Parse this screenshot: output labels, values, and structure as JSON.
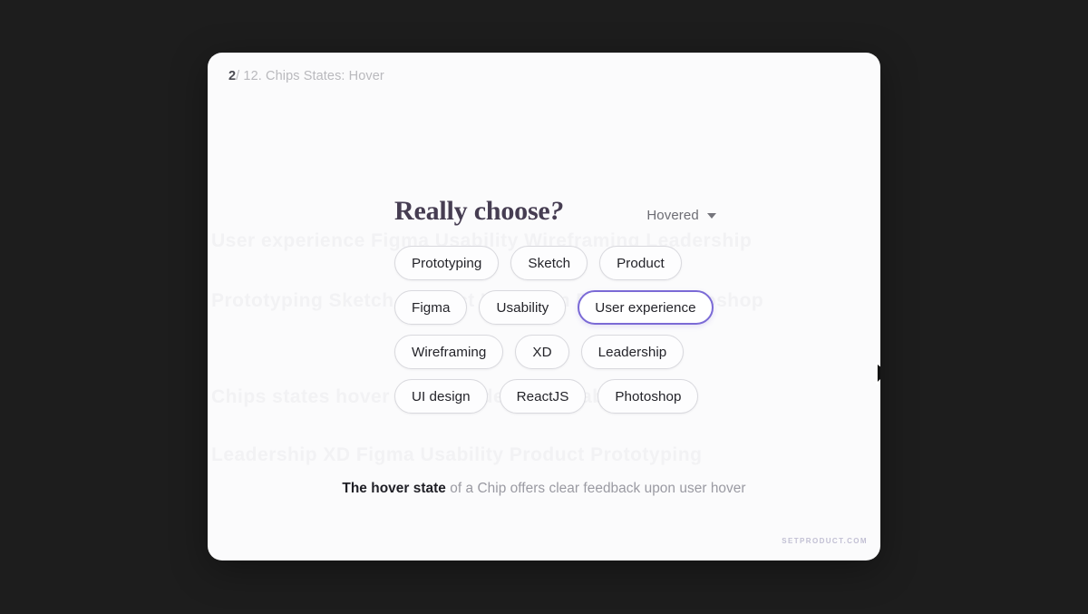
{
  "background_color": "#1d1d1d",
  "card": {
    "background_color": "#fbfbfc",
    "header": {
      "step_number": "2",
      "step_rest": "/ 12. Chips States: Hover"
    },
    "title": {
      "text_main": "Really choose",
      "text_qmark": "?",
      "color": "#463d52"
    },
    "state_select": {
      "label": "Hovered",
      "caret_icon": "chevron-down-icon"
    },
    "chips": {
      "hovered_label": "User experience",
      "hover_border_color": "#7b6ad6",
      "default_border_color": "#d9d9de",
      "rows": [
        [
          "Prototyping",
          "Sketch",
          "Product"
        ],
        [
          "Figma",
          "Usability",
          "User experience"
        ],
        [
          "Wireframing",
          "XD",
          "Leadership"
        ],
        [
          "UI design",
          "ReactJS",
          "Photoshop"
        ]
      ]
    },
    "cursor": {
      "icon": "mouse-pointer-icon"
    },
    "caption": {
      "strong": "The hover state",
      "rest": "of a Chip offers clear feedback upon user hover"
    },
    "watermark": {
      "text": "SETPRODUCT.COM",
      "color": "#c2c0d4"
    },
    "ghost_text_lines": [
      "User experience Figma Usability Wireframing Leadership",
      "Prototyping Sketch Product UI design ReactJS Photoshop",
      "Chips states hover selected default disabled focus",
      "Leadership XD Figma Usability Product Prototyping"
    ]
  }
}
